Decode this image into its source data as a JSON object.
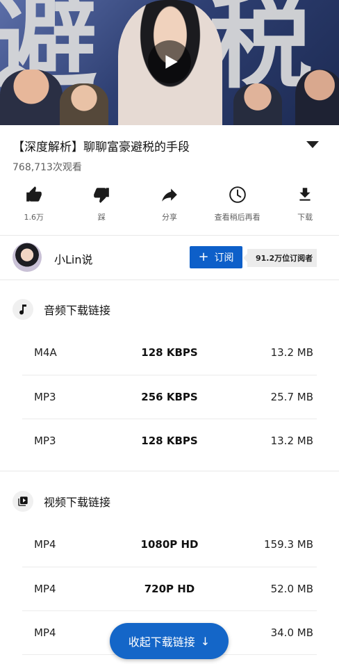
{
  "video": {
    "overlay_left": "避",
    "overlay_right": "税"
  },
  "title": "【深度解析】聊聊富豪避税的手段",
  "views": "768,713次观看",
  "actions": [
    {
      "label": "1.6万",
      "icon": "thumbs-up-icon"
    },
    {
      "label": "踩",
      "icon": "thumbs-down-icon"
    },
    {
      "label": "分享",
      "icon": "share-icon"
    },
    {
      "label": "查看稍后再看",
      "icon": "clock-icon"
    },
    {
      "label": "下载",
      "icon": "download-icon"
    }
  ],
  "channel": {
    "name": "小Lin说",
    "subscribe_label": "订阅",
    "subscribers": "91.2万位订阅者"
  },
  "audio_section": {
    "title": "音频下载链接",
    "icon": "music-note-icon",
    "rows": [
      {
        "format": "M4A",
        "quality": "128 KBPS",
        "size": "13.2 MB"
      },
      {
        "format": "MP3",
        "quality": "256 KBPS",
        "size": "25.7 MB"
      },
      {
        "format": "MP3",
        "quality": "128 KBPS",
        "size": "13.2 MB"
      }
    ]
  },
  "video_section": {
    "title": "视频下载链接",
    "icon": "video-library-icon",
    "rows": [
      {
        "format": "MP4",
        "quality": "1080P HD",
        "size": "159.3 MB"
      },
      {
        "format": "MP4",
        "quality": "720P HD",
        "size": "52.0 MB"
      },
      {
        "format": "MP4",
        "quality": "",
        "size": "34.0 MB"
      }
    ]
  },
  "collapse_button": {
    "label": "收起下载链接",
    "arrow": "↓"
  },
  "colors": {
    "accent": "#1466c8",
    "subscribe": "#0d5fc9",
    "secondary_text": "#606060"
  }
}
